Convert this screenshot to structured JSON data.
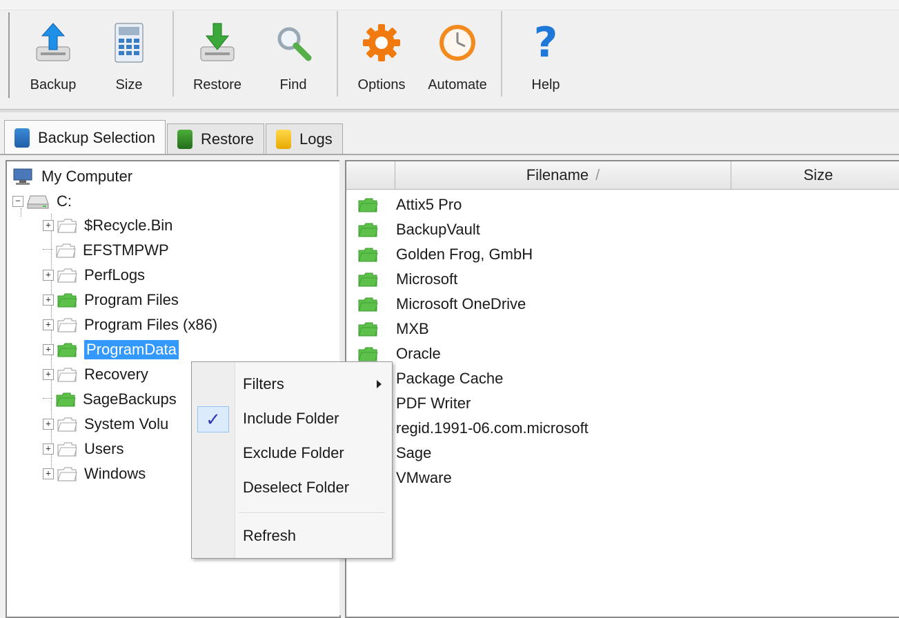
{
  "toolbar": {
    "buttons": [
      {
        "label": "Backup",
        "icon": "backup-upload-icon"
      },
      {
        "label": "Size",
        "icon": "calculator-icon"
      },
      {
        "label": "Restore",
        "icon": "restore-download-icon"
      },
      {
        "label": "Find",
        "icon": "magnifier-icon"
      },
      {
        "label": "Options",
        "icon": "gear-icon"
      },
      {
        "label": "Automate",
        "icon": "clock-icon"
      },
      {
        "label": "Help",
        "icon": "question-mark-icon"
      }
    ]
  },
  "tabs": [
    {
      "label": "Backup Selection",
      "active": true,
      "icon": "database-icon",
      "color": "#1f6fb5"
    },
    {
      "label": "Restore",
      "active": false,
      "icon": "database-icon",
      "color": "#2d8a2d"
    },
    {
      "label": "Logs",
      "active": false,
      "icon": "log-icon",
      "color": "#e8b400"
    }
  ],
  "tree": {
    "root": "My Computer",
    "drive": "C:",
    "items": [
      {
        "label": "$Recycle.Bin",
        "expandable": true,
        "green": false
      },
      {
        "label": "EFSTMPWP",
        "expandable": false,
        "green": false
      },
      {
        "label": "PerfLogs",
        "expandable": true,
        "green": false
      },
      {
        "label": "Program Files",
        "expandable": true,
        "green": true
      },
      {
        "label": "Program Files (x86)",
        "expandable": true,
        "green": false
      },
      {
        "label": "ProgramData",
        "expandable": true,
        "green": true,
        "selected": true
      },
      {
        "label": "Recovery",
        "expandable": true,
        "green": false
      },
      {
        "label": "SageBackups",
        "expandable": false,
        "green": true
      },
      {
        "label": "System Volu",
        "expandable": true,
        "green": false
      },
      {
        "label": "Users",
        "expandable": true,
        "green": false
      },
      {
        "label": "Windows",
        "expandable": true,
        "green": false
      }
    ]
  },
  "grid": {
    "columns": [
      "",
      "Filename",
      "Size"
    ],
    "sort_indicator": "/",
    "files": [
      {
        "name": "Attix5 Pro",
        "green": true
      },
      {
        "name": "BackupVault",
        "green": true
      },
      {
        "name": "Golden Frog, GmbH",
        "green": true
      },
      {
        "name": "Microsoft",
        "green": true
      },
      {
        "name": "Microsoft OneDrive",
        "green": true
      },
      {
        "name": "MXB",
        "green": true
      },
      {
        "name": "Oracle",
        "green": true
      },
      {
        "name": "Package Cache",
        "green": false
      },
      {
        "name": "PDF Writer",
        "green": false
      },
      {
        "name": "regid.1991-06.com.microsoft",
        "green": false
      },
      {
        "name": "Sage",
        "green": false
      },
      {
        "name": "VMware",
        "green": false
      }
    ]
  },
  "context_menu": {
    "items": [
      {
        "label": "Filters",
        "submenu": true
      },
      {
        "label": "Include Folder",
        "checked": true
      },
      {
        "label": "Exclude Folder"
      },
      {
        "label": "Deselect Folder"
      },
      {
        "label": "Refresh"
      }
    ]
  },
  "colors": {
    "selection": "#3399ff",
    "folder_green": "#5cc04a",
    "folder_gray": "#ffffff",
    "check": "#2a3bb5"
  }
}
